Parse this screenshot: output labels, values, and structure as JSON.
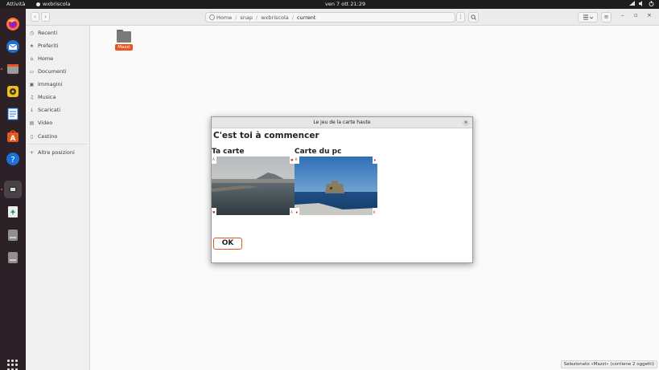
{
  "topbar": {
    "activities": "Attività",
    "app_name": "wxbriscola",
    "clock": "ven 7 ott  21:29"
  },
  "dock": {
    "items": [
      "firefox-icon",
      "thunderbird-icon",
      "files-icon",
      "rhythmbox-icon",
      "writer-icon",
      "app-center-icon",
      "help-icon",
      "wxbriscola-icon",
      "trash-icon",
      "drive-icon",
      "drive-icon"
    ]
  },
  "file_manager": {
    "path": [
      "Home",
      "snap",
      "wxbriscola",
      "current"
    ],
    "sidebar": [
      {
        "label": "Recenti",
        "icon": "clock-icon"
      },
      {
        "label": "Preferiti",
        "icon": "star-icon"
      },
      {
        "label": "Home",
        "icon": "home-icon"
      },
      {
        "label": "Documenti",
        "icon": "document-icon"
      },
      {
        "label": "Immagini",
        "icon": "image-icon"
      },
      {
        "label": "Musica",
        "icon": "music-icon"
      },
      {
        "label": "Scaricati",
        "icon": "download-icon"
      },
      {
        "label": "Video",
        "icon": "video-icon"
      },
      {
        "label": "Cestino",
        "icon": "trash-icon"
      },
      {
        "label": "Altre posizioni",
        "icon": "plus-icon"
      }
    ],
    "folder_label": "Mazzi",
    "status": "Selezionato «Mazzi» (contiene 2 oggetti)"
  },
  "dialog": {
    "title": "Le jeu de la carte haute",
    "heading": "C'est toi à commencer",
    "your_card_label": "Ta carte",
    "pc_card_label": "Carte du pc",
    "ok_label": "OK"
  },
  "colors": {
    "accent": "#e95420",
    "dock_bg": "#2b2127",
    "topbar_bg": "#1d1d1d"
  }
}
